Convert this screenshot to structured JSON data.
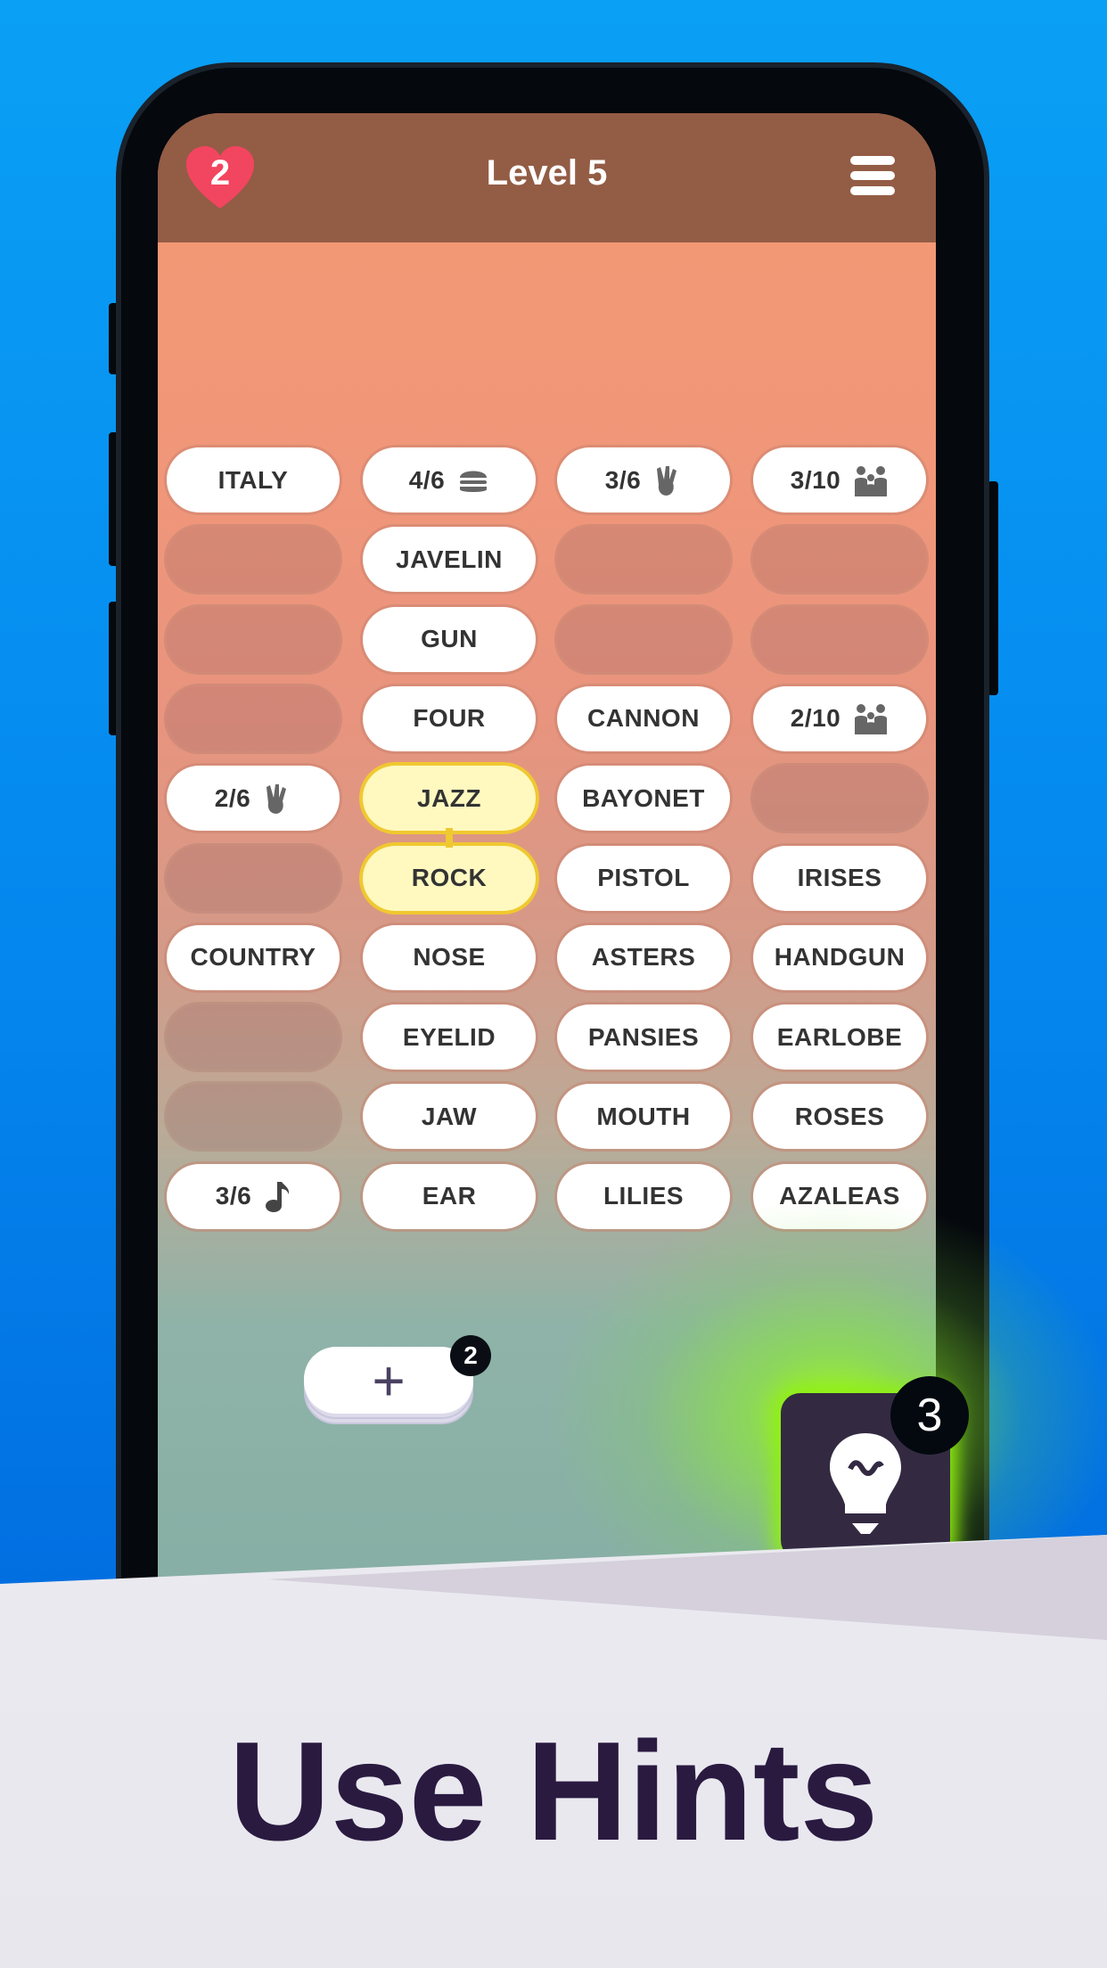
{
  "header": {
    "lives": "2",
    "title": "Level 5",
    "menu_icon": "hamburger-icon"
  },
  "colors": {
    "header": "#935c45",
    "selected": "#fff9c0",
    "selected_border": "#f0c830",
    "hint_button": "#332a42",
    "caption": "#2a1a40"
  },
  "grid": [
    [
      {
        "t": "word",
        "text": "ITALY"
      },
      {
        "t": "count",
        "text": "4/6",
        "icon": "burger"
      },
      {
        "t": "count",
        "text": "3/6",
        "icon": "hand"
      },
      {
        "t": "count",
        "text": "3/10",
        "icon": "people"
      }
    ],
    [
      {
        "t": "empty"
      },
      {
        "t": "word",
        "text": "JAVELIN"
      },
      {
        "t": "empty"
      },
      {
        "t": "empty"
      }
    ],
    [
      {
        "t": "empty"
      },
      {
        "t": "word",
        "text": "GUN"
      },
      {
        "t": "empty"
      },
      {
        "t": "empty"
      }
    ],
    [
      {
        "t": "empty"
      },
      {
        "t": "word",
        "text": "FOUR"
      },
      {
        "t": "word",
        "text": "CANNON"
      },
      {
        "t": "count",
        "text": "2/10",
        "icon": "people"
      }
    ],
    [
      {
        "t": "count",
        "text": "2/6",
        "icon": "hand"
      },
      {
        "t": "sel",
        "text": "JAZZ"
      },
      {
        "t": "word",
        "text": "BAYONET"
      },
      {
        "t": "empty"
      }
    ],
    [
      {
        "t": "empty"
      },
      {
        "t": "sel",
        "text": "ROCK"
      },
      {
        "t": "word",
        "text": "PISTOL"
      },
      {
        "t": "word",
        "text": "IRISES"
      }
    ],
    [
      {
        "t": "word",
        "text": "COUNTRY"
      },
      {
        "t": "word",
        "text": "NOSE"
      },
      {
        "t": "word",
        "text": "ASTERS"
      },
      {
        "t": "word",
        "text": "HANDGUN"
      }
    ],
    [
      {
        "t": "empty"
      },
      {
        "t": "word",
        "text": "EYELID"
      },
      {
        "t": "word",
        "text": "PANSIES"
      },
      {
        "t": "word",
        "text": "EARLOBE"
      }
    ],
    [
      {
        "t": "empty"
      },
      {
        "t": "word",
        "text": "JAW"
      },
      {
        "t": "word",
        "text": "MOUTH"
      },
      {
        "t": "word",
        "text": "ROSES"
      }
    ],
    [
      {
        "t": "count",
        "text": "3/6",
        "icon": "music-note"
      },
      {
        "t": "word",
        "text": "EAR"
      },
      {
        "t": "word",
        "text": "LILIES"
      },
      {
        "t": "word",
        "text": "AZALEAS"
      }
    ]
  ],
  "add_button": {
    "label": "+",
    "badge": "2"
  },
  "hint_button": {
    "badge": "3",
    "icon": "lightbulb-icon"
  },
  "caption": "Use Hints"
}
